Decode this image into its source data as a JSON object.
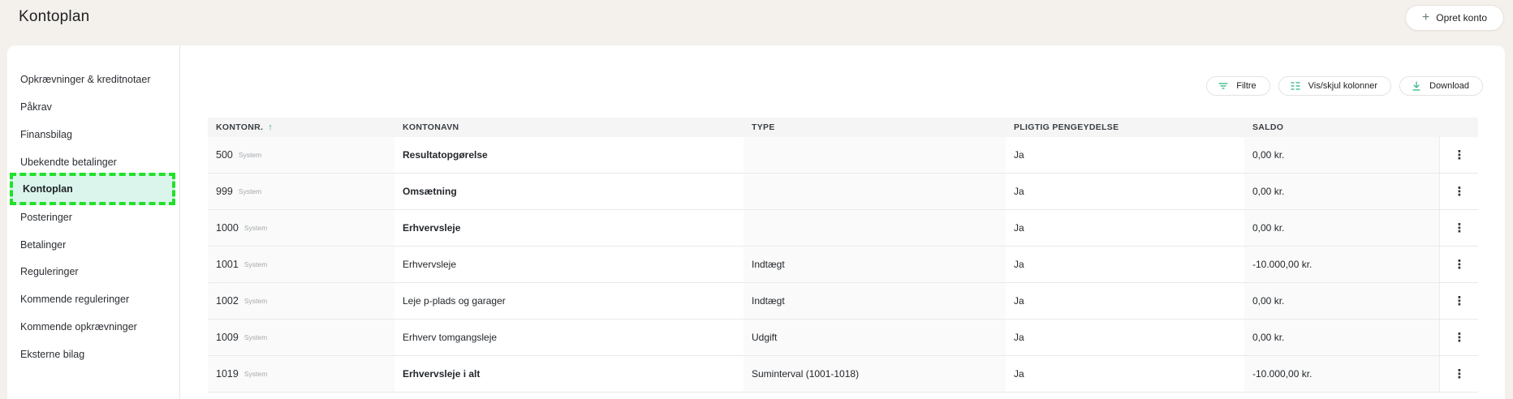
{
  "header": {
    "title": "Kontoplan",
    "create_button": {
      "label": "Opret konto",
      "icon": "plus-icon"
    }
  },
  "sidebar": {
    "items": [
      {
        "label": "Opkrævninger & kreditnotaer",
        "active": false
      },
      {
        "label": "Påkrav",
        "active": false
      },
      {
        "label": "Finansbilag",
        "active": false
      },
      {
        "label": "Ubekendte betalinger",
        "active": false
      },
      {
        "label": "Kontoplan",
        "active": true
      },
      {
        "label": "Posteringer",
        "active": false
      },
      {
        "label": "Betalinger",
        "active": false
      },
      {
        "label": "Reguleringer",
        "active": false
      },
      {
        "label": "Kommende reguleringer",
        "active": false
      },
      {
        "label": "Kommende opkrævninger",
        "active": false
      },
      {
        "label": "Eksterne bilag",
        "active": false
      }
    ],
    "active_highlight": "#dbf5ec",
    "active_border": "#22e02a"
  },
  "toolbar": {
    "filter_label": "Filtre",
    "columns_label": "Vis/skjul kolonner",
    "download_label": "Download",
    "accent_color": "#27b57c"
  },
  "table": {
    "columns": [
      "KONTONR.",
      "KONTONAVN",
      "TYPE",
      "PLIGTIG PENGEYDELSE",
      "SALDO"
    ],
    "sort_indicator": "↑",
    "rows": [
      {
        "number": "500",
        "tag": "System",
        "name": "Resultatopgørelse",
        "bold": true,
        "type": "",
        "pligtig": "Ja",
        "saldo": "0,00 kr."
      },
      {
        "number": "999",
        "tag": "System",
        "name": "Omsætning",
        "bold": true,
        "type": "",
        "pligtig": "Ja",
        "saldo": "0,00 kr."
      },
      {
        "number": "1000",
        "tag": "System",
        "name": "Erhvervsleje",
        "bold": true,
        "type": "",
        "pligtig": "Ja",
        "saldo": "0,00 kr."
      },
      {
        "number": "1001",
        "tag": "System",
        "name": "Erhvervsleje",
        "bold": false,
        "type": "Indtægt",
        "pligtig": "Ja",
        "saldo": "-10.000,00 kr."
      },
      {
        "number": "1002",
        "tag": "System",
        "name": "Leje p-plads og garager",
        "bold": false,
        "type": "Indtægt",
        "pligtig": "Ja",
        "saldo": "0,00 kr."
      },
      {
        "number": "1009",
        "tag": "System",
        "name": "Erhverv tomgangsleje",
        "bold": false,
        "type": "Udgift",
        "pligtig": "Ja",
        "saldo": "0,00 kr."
      },
      {
        "number": "1019",
        "tag": "System",
        "name": "Erhvervsleje i alt",
        "bold": true,
        "type": "Suminterval (1001-1018)",
        "pligtig": "Ja",
        "saldo": "-10.000,00 kr."
      }
    ],
    "row_action_icon": "more-vertical-icon"
  }
}
